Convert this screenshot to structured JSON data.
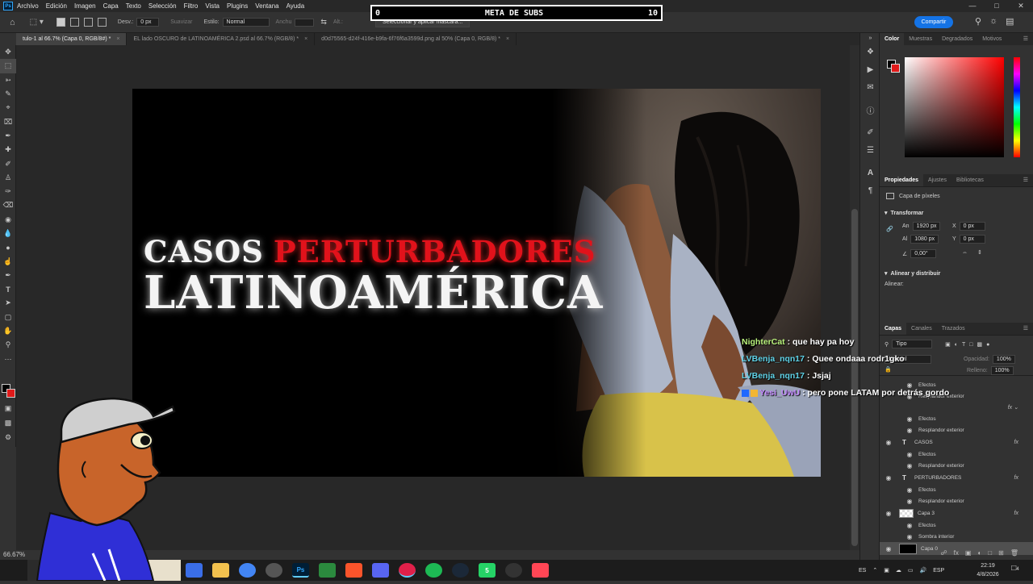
{
  "app": {
    "logo": "Ps"
  },
  "menu": [
    "Archivo",
    "Edición",
    "Imagen",
    "Capa",
    "Texto",
    "Selección",
    "Filtro",
    "Vista",
    "Plugins",
    "Ventana",
    "Ayuda"
  ],
  "subs_goal": {
    "label": "META DE SUBS",
    "current": "0",
    "target": "10"
  },
  "options": {
    "feather_label": "Desv.:",
    "feather_value": "0 px",
    "smooth_label": "Suavizar",
    "style_label": "Estilo:",
    "style_value": "Normal",
    "width_label": "Anchu",
    "height_label": "Alt.:",
    "mask_button": "Seleccionar y aplicar máscara..."
  },
  "share_button": "Compartir",
  "tabs": [
    {
      "label": "tulo-1 al 66.7% (Capa 0, RGB/8#) *",
      "active": true
    },
    {
      "label": "EL lado OSCURO de LATINOAMÉRICA 2.psd al 66.7% (RGB/8) *",
      "active": false
    },
    {
      "label": "d0d75565-d24f-416e-b9fa-6f76f6a3599d.png al 50% (Capa 0, RGB/8) *",
      "active": false
    }
  ],
  "thumbnail": {
    "word_white": "CASOS",
    "word_red": "PERTURBADORES",
    "line2": "LATINOAMÉRICA"
  },
  "chat": [
    {
      "user": "NighterCat",
      "color": "#b9f27c",
      "message": " : que hay pa hoy"
    },
    {
      "user": "LVBenja_nqn17",
      "color": "#5fd3e8",
      "message": " : Quee ondaaa rodr1gko"
    },
    {
      "user": "LVBenja_nqn17",
      "color": "#5fd3e8",
      "message": " : Jsjaj"
    },
    {
      "user": "Yesi_UwU",
      "color": "#c58cff",
      "message": " : pero pone LATAM por detrás gordo"
    }
  ],
  "status": {
    "zoom": "66.67%",
    "doc": "px"
  },
  "color_panel": {
    "tabs": [
      "Color",
      "Muestras",
      "Degradados",
      "Motivos"
    ]
  },
  "properties": {
    "tabs": [
      "Propiedades",
      "Ajustes",
      "Bibliotecas"
    ],
    "layer_type": "Capa de píxeles",
    "transform_label": "Transformar",
    "w_label": "An",
    "w_value": "1920 px",
    "x_label": "X",
    "x_value": "0 px",
    "h_label": "Al",
    "h_value": "1080 px",
    "y_label": "Y",
    "y_value": "0 px",
    "angle_value": "0,00°",
    "align_label": "Alinear y distribuir",
    "align_sub": "Alinear:"
  },
  "layers": {
    "tabs": [
      "Capas",
      "Canales",
      "Trazados"
    ],
    "filter_value": "Tipo",
    "blend_value": "Normal",
    "opacity_label": "Opacidad:",
    "opacity_value": "100%",
    "fill_label": "Relleno:",
    "fill_value": "100%",
    "rows": [
      {
        "kind": "sub",
        "label": "Efectos"
      },
      {
        "kind": "sub2",
        "label": "Resplandor exterior"
      },
      {
        "kind": "gap",
        "label": ""
      },
      {
        "kind": "sub",
        "label": "Efectos"
      },
      {
        "kind": "sub2",
        "label": "Resplandor exterior"
      },
      {
        "kind": "text",
        "label": "CASOS",
        "fx": "fx"
      },
      {
        "kind": "sub",
        "label": "Efectos"
      },
      {
        "kind": "sub2",
        "label": "Resplandor exterior"
      },
      {
        "kind": "text",
        "label": "PERTURBADORES",
        "fx": "fx"
      },
      {
        "kind": "sub",
        "label": "Efectos"
      },
      {
        "kind": "sub2",
        "label": "Resplandor exterior"
      },
      {
        "kind": "pixel",
        "label": "Capa 3",
        "fx": "fx"
      },
      {
        "kind": "sub",
        "label": "Efectos"
      },
      {
        "kind": "sub2",
        "label": "Sombra interior"
      },
      {
        "kind": "black",
        "label": "Capa 0",
        "selected": true
      }
    ]
  },
  "taskbar": {
    "apps": [
      {
        "name": "copilot",
        "label": "",
        "color": "#3a6ee8"
      },
      {
        "name": "explorer",
        "label": "",
        "color": "#f2c14e"
      },
      {
        "name": "chrome",
        "label": "",
        "color": "#4285f4"
      },
      {
        "name": "obs",
        "label": "",
        "color": "#555"
      },
      {
        "name": "photoshop",
        "label": "Ps",
        "color": "#001e36"
      },
      {
        "name": "ninja",
        "label": "",
        "color": "#2b8a3e"
      },
      {
        "name": "brave",
        "label": "",
        "color": "#fb542b"
      },
      {
        "name": "discord",
        "label": "",
        "color": "#5865f2"
      },
      {
        "name": "opera-gx",
        "label": "",
        "color": "#e0204a"
      },
      {
        "name": "spotify",
        "label": "",
        "color": "#1db954"
      },
      {
        "name": "steam",
        "label": "",
        "color": "#1b2838"
      },
      {
        "name": "whatsapp",
        "label": "5",
        "color": "#25d366"
      },
      {
        "name": "recorder",
        "label": "",
        "color": "#333"
      },
      {
        "name": "valorant",
        "label": "",
        "color": "#ff4655"
      }
    ],
    "lang": "ES",
    "kb": "ESP",
    "time": "22:19",
    "date": "4/8/2026",
    "notifications": "4"
  }
}
